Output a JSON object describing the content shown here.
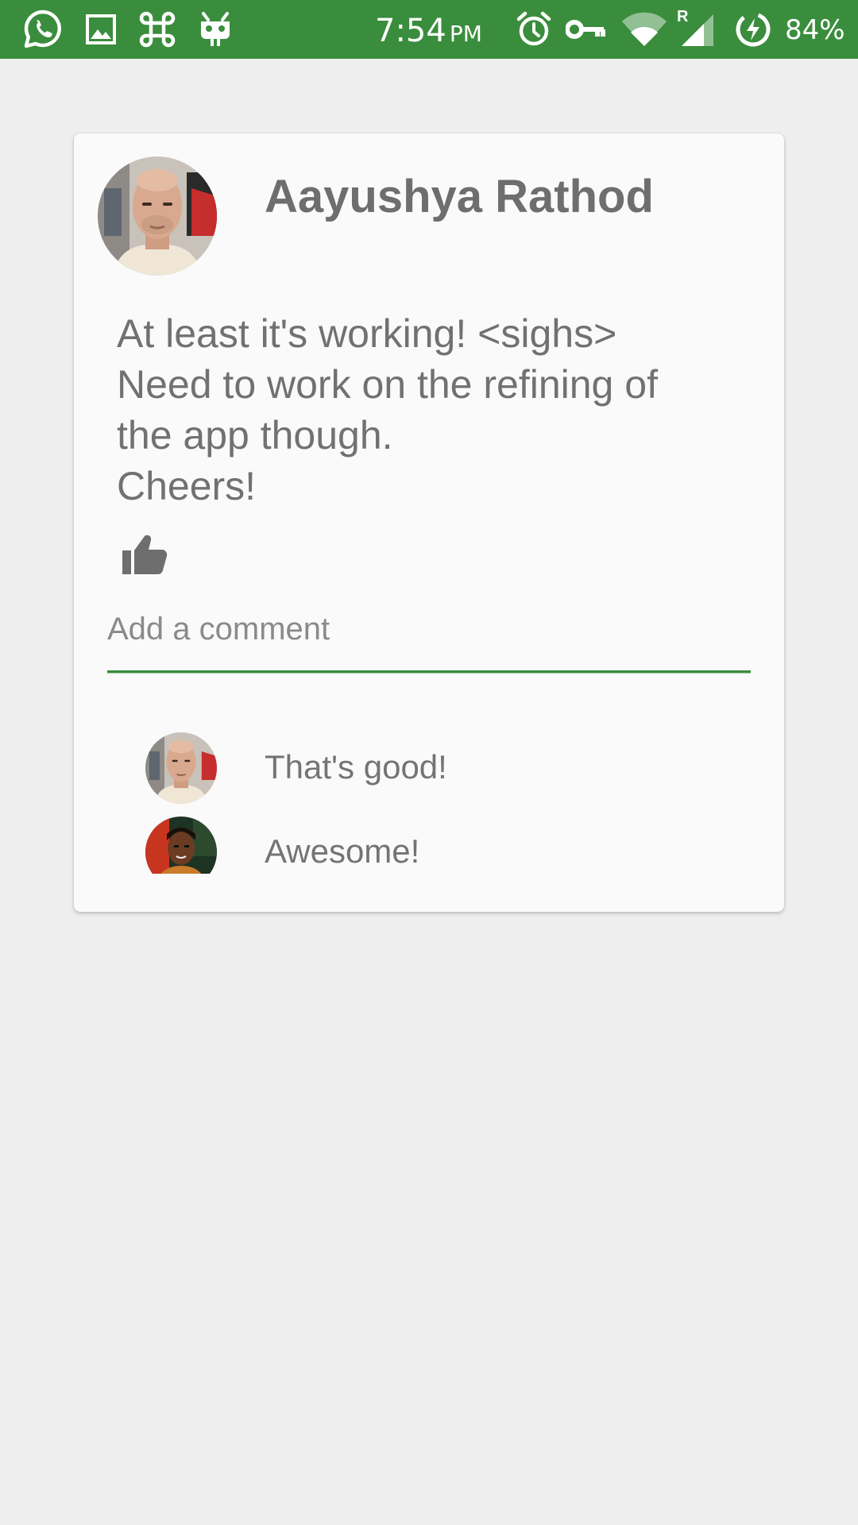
{
  "status_bar": {
    "time": "7:54",
    "ampm": "PM",
    "battery_percent": "84%",
    "left_icons": [
      "whatsapp-icon",
      "gallery-icon",
      "command-icon",
      "cyanogen-icon"
    ],
    "right_icons": [
      "alarm-icon",
      "vpn-key-icon",
      "wifi-icon",
      "roaming-signal-icon",
      "battery-charging-icon"
    ],
    "roaming_indicator": "R",
    "background_color": "#3a8d3c"
  },
  "post": {
    "author_name": "Aayushya Rathod",
    "body_lines": [
      "At least it's working! <sighs>",
      "Need to work on the refining of",
      "the app though.",
      "Cheers!"
    ],
    "like_icon": "thumbs-up-icon"
  },
  "comment_box": {
    "placeholder": "Add a comment",
    "accent_color": "#3a8d3c"
  },
  "comments": [
    {
      "text": "That's good!"
    },
    {
      "text": "Awesome!"
    }
  ]
}
